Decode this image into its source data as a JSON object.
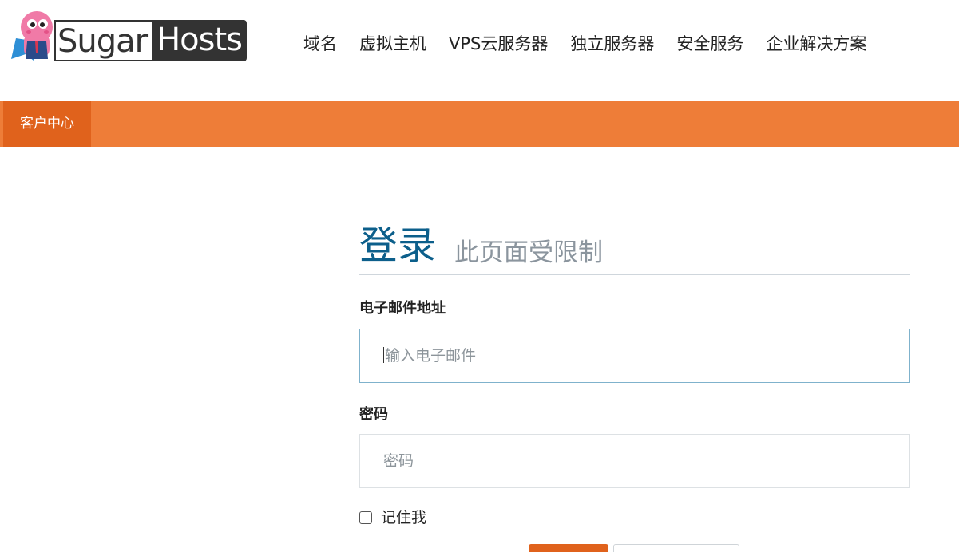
{
  "logo": {
    "text_sugar": "Sugar",
    "text_hosts": "Hosts"
  },
  "nav": {
    "items": [
      {
        "label": "域名"
      },
      {
        "label": "虚拟主机"
      },
      {
        "label": "VPS云服务器"
      },
      {
        "label": "独立服务器"
      },
      {
        "label": "安全服务"
      },
      {
        "label": "企业解决方案"
      }
    ]
  },
  "subnav": {
    "active_tab": "客户中心"
  },
  "login": {
    "title": "登录",
    "subtitle": "此页面受限制",
    "email_label": "电子邮件地址",
    "email_placeholder": "输入电子邮件",
    "password_label": "密码",
    "password_placeholder": "密码",
    "remember_label": "记住我",
    "remember_checked": false
  },
  "colors": {
    "brand_orange": "#ee7d38",
    "brand_orange_dark": "#e0621c",
    "title_blue": "#0c5f8b"
  }
}
